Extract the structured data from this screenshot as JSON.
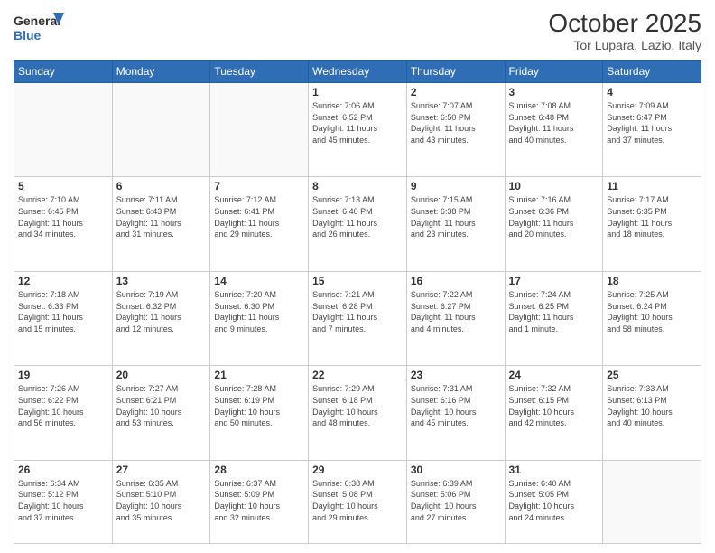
{
  "header": {
    "logo_line1": "General",
    "logo_line2": "Blue",
    "title": "October 2025",
    "subtitle": "Tor Lupara, Lazio, Italy"
  },
  "days_of_week": [
    "Sunday",
    "Monday",
    "Tuesday",
    "Wednesday",
    "Thursday",
    "Friday",
    "Saturday"
  ],
  "weeks": [
    [
      {
        "day": "",
        "info": ""
      },
      {
        "day": "",
        "info": ""
      },
      {
        "day": "",
        "info": ""
      },
      {
        "day": "1",
        "info": "Sunrise: 7:06 AM\nSunset: 6:52 PM\nDaylight: 11 hours\nand 45 minutes."
      },
      {
        "day": "2",
        "info": "Sunrise: 7:07 AM\nSunset: 6:50 PM\nDaylight: 11 hours\nand 43 minutes."
      },
      {
        "day": "3",
        "info": "Sunrise: 7:08 AM\nSunset: 6:48 PM\nDaylight: 11 hours\nand 40 minutes."
      },
      {
        "day": "4",
        "info": "Sunrise: 7:09 AM\nSunset: 6:47 PM\nDaylight: 11 hours\nand 37 minutes."
      }
    ],
    [
      {
        "day": "5",
        "info": "Sunrise: 7:10 AM\nSunset: 6:45 PM\nDaylight: 11 hours\nand 34 minutes."
      },
      {
        "day": "6",
        "info": "Sunrise: 7:11 AM\nSunset: 6:43 PM\nDaylight: 11 hours\nand 31 minutes."
      },
      {
        "day": "7",
        "info": "Sunrise: 7:12 AM\nSunset: 6:41 PM\nDaylight: 11 hours\nand 29 minutes."
      },
      {
        "day": "8",
        "info": "Sunrise: 7:13 AM\nSunset: 6:40 PM\nDaylight: 11 hours\nand 26 minutes."
      },
      {
        "day": "9",
        "info": "Sunrise: 7:15 AM\nSunset: 6:38 PM\nDaylight: 11 hours\nand 23 minutes."
      },
      {
        "day": "10",
        "info": "Sunrise: 7:16 AM\nSunset: 6:36 PM\nDaylight: 11 hours\nand 20 minutes."
      },
      {
        "day": "11",
        "info": "Sunrise: 7:17 AM\nSunset: 6:35 PM\nDaylight: 11 hours\nand 18 minutes."
      }
    ],
    [
      {
        "day": "12",
        "info": "Sunrise: 7:18 AM\nSunset: 6:33 PM\nDaylight: 11 hours\nand 15 minutes."
      },
      {
        "day": "13",
        "info": "Sunrise: 7:19 AM\nSunset: 6:32 PM\nDaylight: 11 hours\nand 12 minutes."
      },
      {
        "day": "14",
        "info": "Sunrise: 7:20 AM\nSunset: 6:30 PM\nDaylight: 11 hours\nand 9 minutes."
      },
      {
        "day": "15",
        "info": "Sunrise: 7:21 AM\nSunset: 6:28 PM\nDaylight: 11 hours\nand 7 minutes."
      },
      {
        "day": "16",
        "info": "Sunrise: 7:22 AM\nSunset: 6:27 PM\nDaylight: 11 hours\nand 4 minutes."
      },
      {
        "day": "17",
        "info": "Sunrise: 7:24 AM\nSunset: 6:25 PM\nDaylight: 11 hours\nand 1 minute."
      },
      {
        "day": "18",
        "info": "Sunrise: 7:25 AM\nSunset: 6:24 PM\nDaylight: 10 hours\nand 58 minutes."
      }
    ],
    [
      {
        "day": "19",
        "info": "Sunrise: 7:26 AM\nSunset: 6:22 PM\nDaylight: 10 hours\nand 56 minutes."
      },
      {
        "day": "20",
        "info": "Sunrise: 7:27 AM\nSunset: 6:21 PM\nDaylight: 10 hours\nand 53 minutes."
      },
      {
        "day": "21",
        "info": "Sunrise: 7:28 AM\nSunset: 6:19 PM\nDaylight: 10 hours\nand 50 minutes."
      },
      {
        "day": "22",
        "info": "Sunrise: 7:29 AM\nSunset: 6:18 PM\nDaylight: 10 hours\nand 48 minutes."
      },
      {
        "day": "23",
        "info": "Sunrise: 7:31 AM\nSunset: 6:16 PM\nDaylight: 10 hours\nand 45 minutes."
      },
      {
        "day": "24",
        "info": "Sunrise: 7:32 AM\nSunset: 6:15 PM\nDaylight: 10 hours\nand 42 minutes."
      },
      {
        "day": "25",
        "info": "Sunrise: 7:33 AM\nSunset: 6:13 PM\nDaylight: 10 hours\nand 40 minutes."
      }
    ],
    [
      {
        "day": "26",
        "info": "Sunrise: 6:34 AM\nSunset: 5:12 PM\nDaylight: 10 hours\nand 37 minutes."
      },
      {
        "day": "27",
        "info": "Sunrise: 6:35 AM\nSunset: 5:10 PM\nDaylight: 10 hours\nand 35 minutes."
      },
      {
        "day": "28",
        "info": "Sunrise: 6:37 AM\nSunset: 5:09 PM\nDaylight: 10 hours\nand 32 minutes."
      },
      {
        "day": "29",
        "info": "Sunrise: 6:38 AM\nSunset: 5:08 PM\nDaylight: 10 hours\nand 29 minutes."
      },
      {
        "day": "30",
        "info": "Sunrise: 6:39 AM\nSunset: 5:06 PM\nDaylight: 10 hours\nand 27 minutes."
      },
      {
        "day": "31",
        "info": "Sunrise: 6:40 AM\nSunset: 5:05 PM\nDaylight: 10 hours\nand 24 minutes."
      },
      {
        "day": "",
        "info": ""
      }
    ]
  ]
}
